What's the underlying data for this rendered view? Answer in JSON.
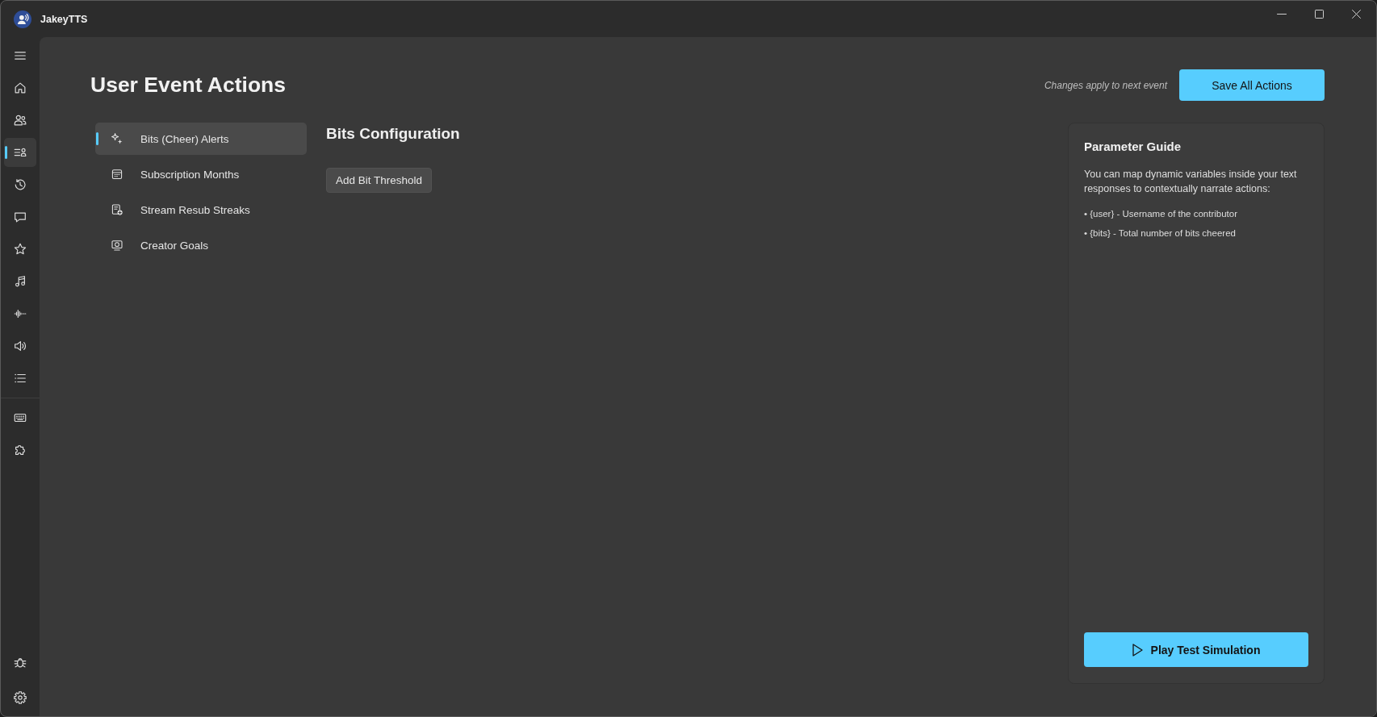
{
  "window": {
    "title": "JakeyTTS"
  },
  "nav_rail": {
    "items": [
      {
        "selected": false
      },
      {
        "selected": false
      },
      {
        "selected": true
      },
      {
        "selected": false
      },
      {
        "selected": false
      },
      {
        "selected": false
      },
      {
        "selected": false
      },
      {
        "selected": false
      },
      {
        "selected": false
      },
      {
        "selected": false
      }
    ],
    "tools": [
      {
        "selected": false
      },
      {
        "selected": false
      }
    ],
    "footer": [
      {
        "selected": false
      },
      {
        "selected": false
      }
    ]
  },
  "page": {
    "title": "User Event Actions",
    "save_note": "Changes apply to next event",
    "save_button": "Save All Actions"
  },
  "categories": [
    {
      "label": "Bits (Cheer) Alerts",
      "selected": true
    },
    {
      "label": "Subscription Months",
      "selected": false
    },
    {
      "label": "Stream Resub Streaks",
      "selected": false
    },
    {
      "label": "Creator Goals",
      "selected": false
    }
  ],
  "configuration": {
    "title": "Bits Configuration",
    "add_button": "Add Bit Threshold"
  },
  "parameter_guide": {
    "title": "Parameter Guide",
    "description": "You can map dynamic variables inside your text responses to contextually narrate actions:",
    "parameters": [
      "• {user} - Username of the contributor",
      "• {bits} - Total number of bits cheered"
    ],
    "play_button": "Play Test Simulation"
  }
}
